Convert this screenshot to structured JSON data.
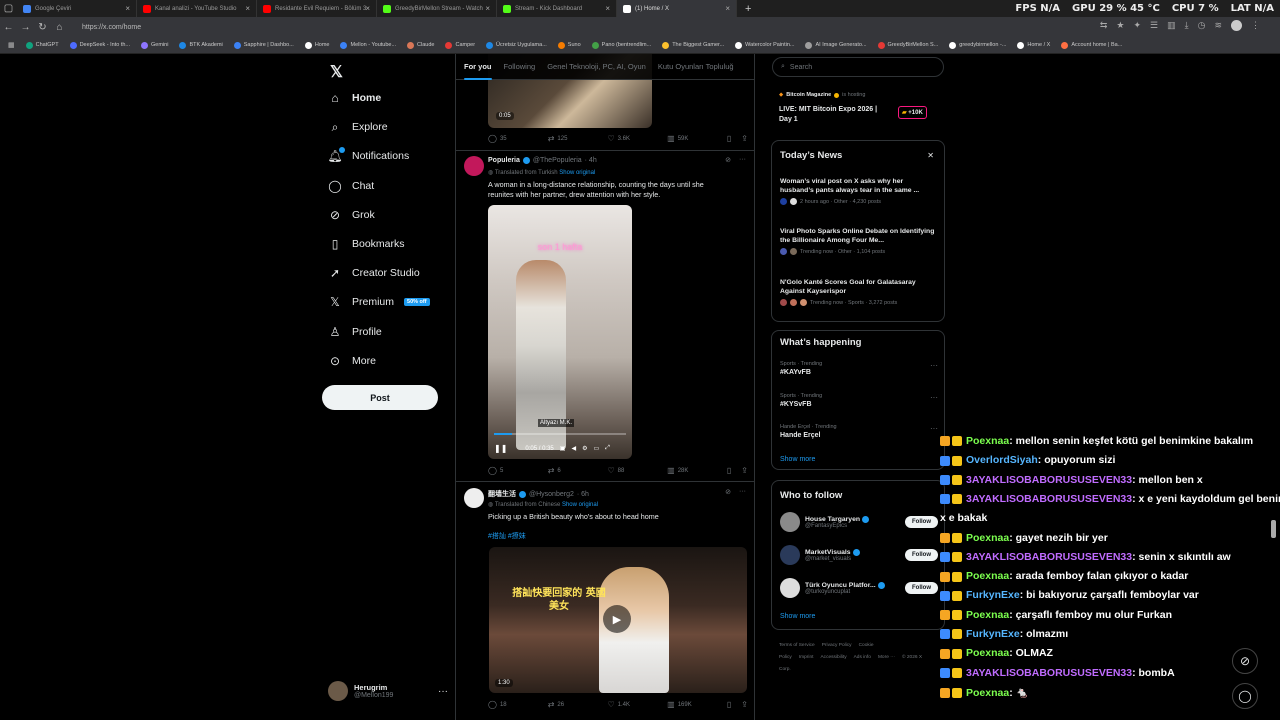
{
  "browser": {
    "tabs": [
      {
        "label": "Google Çeviri",
        "color": "#4285f4",
        "active": false
      },
      {
        "label": "Kanal analizi - YouTube Studio",
        "color": "#ff0000",
        "active": false
      },
      {
        "label": "Residante Evil Requiem - Bölüm 3",
        "color": "#ff0000",
        "active": false
      },
      {
        "label": "GreedyBirMellon Stream - Watch",
        "color": "#53fc18",
        "active": false
      },
      {
        "label": "Stream - Kick Dashboard",
        "color": "#53fc18",
        "active": false
      },
      {
        "label": "(1) Home / X",
        "color": "#ffffff",
        "active": true
      }
    ],
    "new_tab": "+",
    "stats": {
      "fps_label": "FPS",
      "fps_value": "N/A",
      "gpu_label": "GPU",
      "gpu_value": "29 % 45 °C",
      "cpu_label": "CPU",
      "cpu_value": "7 %",
      "lat_label": "LAT",
      "lat_value": "N/A"
    },
    "url": "https://x.com/home",
    "bookmarks": [
      {
        "label": "ChatGPT",
        "color": "#10a37f"
      },
      {
        "label": "DeepSeek - Into th...",
        "color": "#4d6bfe"
      },
      {
        "label": "Gemini",
        "color": "#8e75ff"
      },
      {
        "label": "BTK Akademi",
        "color": "#1e88e5"
      },
      {
        "label": "Sapphire | Dashbo...",
        "color": "#3b82f6"
      },
      {
        "label": "Home",
        "color": "#ffffff"
      },
      {
        "label": "Mellon - Youtube...",
        "color": "#3b82f6"
      },
      {
        "label": "Claude",
        "color": "#d97757"
      },
      {
        "label": "Camper",
        "color": "#e53935"
      },
      {
        "label": "Ücretsiz Uygulama...",
        "color": "#1e88e5"
      },
      {
        "label": "Suno",
        "color": "#f57c00"
      },
      {
        "label": "Pano (bentrendlim...",
        "color": "#43a047"
      },
      {
        "label": "The Biggest Gamer...",
        "color": "#fbc02d"
      },
      {
        "label": "Watercolor Paintin...",
        "color": "#ffffff"
      },
      {
        "label": "AI Image Generato...",
        "color": "#9e9e9e"
      },
      {
        "label": "GreedyBirMellon S...",
        "color": "#e53935"
      },
      {
        "label": "greedybirmellon -...",
        "color": "#ffffff"
      },
      {
        "label": "Home / X",
        "color": "#ffffff"
      },
      {
        "label": "Account home | Ba...",
        "color": "#ff7043"
      }
    ]
  },
  "nav": {
    "logo": "𝕏",
    "items": [
      {
        "label": "Home",
        "icon": "home-icon",
        "glyph": "⌂",
        "bold": true
      },
      {
        "label": "Explore",
        "icon": "search-icon",
        "glyph": "⌕"
      },
      {
        "label": "Notifications",
        "icon": "bell-icon",
        "glyph": "🔔︎",
        "badge": true
      },
      {
        "label": "Chat",
        "icon": "chat-icon",
        "glyph": "◯"
      },
      {
        "label": "Grok",
        "icon": "grok-icon",
        "glyph": "⊘"
      },
      {
        "label": "Bookmarks",
        "icon": "bookmark-icon",
        "glyph": "▯"
      },
      {
        "label": "Creator Studio",
        "icon": "rocket-icon",
        "glyph": "➚"
      },
      {
        "label": "Premium",
        "icon": "x-icon",
        "glyph": "𝕏",
        "tag": "50% off"
      },
      {
        "label": "Profile",
        "icon": "person-icon",
        "glyph": "♙"
      },
      {
        "label": "More",
        "icon": "more-circle-icon",
        "glyph": "⊙"
      }
    ],
    "post_label": "Post",
    "user": {
      "name": "Herugrim",
      "handle": "@Mellon199",
      "more": "···"
    }
  },
  "feed": {
    "tabs": [
      "For you",
      "Following",
      "Genel Teknoloji, PC, AI, Oyun",
      "Kutu Oyunları Topluluğ"
    ],
    "top_video_time": "0:05",
    "top_actions": {
      "replies": "35",
      "reposts": "125",
      "likes": "3.6K",
      "views": "59K"
    },
    "tweet1": {
      "name": "Populeria",
      "handle": "@ThePopuleria",
      "time": "· 4h",
      "translated": "Translated from Turkish",
      "show_original": "Show original",
      "text": "A woman in a long-distance relationship, counting the days until she reunites with her partner, drew attention with her style.",
      "video_caption": "son 1 hafta",
      "video_subtitle": "Altyazı M.K.",
      "video_time": "0:05 / 0:35",
      "actions": {
        "replies": "5",
        "reposts": "6",
        "likes": "88",
        "views": "28K"
      }
    },
    "tweet2": {
      "name": "翻墙生活",
      "handle": "@Hysonberg2",
      "time": "· 6h",
      "translated": "Translated from Chinese",
      "show_original": "Show original",
      "text": "Picking up a British beauty who's about to head home",
      "tags": "#搭訕 #撩妹",
      "video_overlay": "搭訕快要回家的 英國美女",
      "video_time": "1:30",
      "actions": {
        "replies": "18",
        "reposts": "26",
        "likes": "1.4K",
        "views": "169K"
      }
    }
  },
  "right": {
    "search_placeholder": "Search",
    "live": {
      "host": "Bitcoin Magazine",
      "hosting": "is hosting",
      "title": "LIVE: MIT Bitcoin Expo 2026 | Day 1",
      "count": "+10K"
    },
    "news": {
      "title": "Today’s News",
      "close": "✕",
      "items": [
        {
          "title": "Woman’s viral post on X asks why her husband’s pants always tear in the same ...",
          "meta": "2 hours ago · Other · 4,230 posts"
        },
        {
          "title": "Viral Photo Sparks Online Debate on Identifying the Billionaire Among Four Me...",
          "meta": "Trending now · Other · 1,104 posts"
        },
        {
          "title": "N'Golo Kanté Scores Goal for Galatasaray Against Kayserispor",
          "meta": "Trending now · Sports · 3,272 posts"
        }
      ]
    },
    "happening": {
      "title": "What’s happening",
      "trends": [
        {
          "context": "Sports · Trending",
          "name": "#KAYvFB"
        },
        {
          "context": "Sports · Trending",
          "name": "#KYSvFB"
        },
        {
          "context": "Hande Erçel · Trending",
          "name": "Hande Erçel"
        }
      ],
      "show_more": "Show more"
    },
    "follow": {
      "title": "Who to follow",
      "items": [
        {
          "name": "House Targaryen",
          "handle": "@FantasyEpics",
          "color": "#8a8a8a"
        },
        {
          "name": "MarketVisuals",
          "handle": "@market_visuals",
          "color": "#2a3a5a"
        },
        {
          "name": "Türk Oyuncu Platfor...",
          "handle": "@turkoyuncuplat",
          "color": "#dddddd"
        }
      ],
      "button": "Follow",
      "show_more": "Show more"
    },
    "footer": [
      "Terms of Service",
      "Privacy Policy",
      "Cookie Policy",
      "Imprint",
      "Accessibility",
      "Ads info",
      "More ···",
      "© 2026 X Corp."
    ]
  },
  "chat": {
    "messages": [
      {
        "user": "Poexnaa",
        "color": "#7cff4f",
        "text": ": mellon senin keşfet kötü gel benimkine bakalım"
      },
      {
        "user": "OverlordSiyah",
        "color": "#56b6ff",
        "text": ": opuyorum sizi"
      },
      {
        "user": "3AYAKLISOBABORUSUSEVEN33",
        "color": "#c06cff",
        "text": ": mellon ben x"
      },
      {
        "user": "3AYAKLISOBABORUSUSEVEN33",
        "color": "#c06cff",
        "text": ": x e yeni kaydoldum gel benim"
      },
      {
        "user": "",
        "color": "#ffffff",
        "text": "x e bakak"
      },
      {
        "user": "Poexnaa",
        "color": "#7cff4f",
        "text": ": gayet nezih bir yer"
      },
      {
        "user": "3AYAKLISOBABORUSUSEVEN33",
        "color": "#c06cff",
        "text": ": senin x sıkıntılı aw"
      },
      {
        "user": "Poexnaa",
        "color": "#7cff4f",
        "text": ": arada femboy falan çıkıyor o kadar"
      },
      {
        "user": "FurkynExe",
        "color": "#56b6ff",
        "text": ": bi bakıyoruz çarşaflı femboylar var"
      },
      {
        "user": "Poexnaa",
        "color": "#7cff4f",
        "text": ": çarşaflı femboy mu olur Furkan"
      },
      {
        "user": "FurkynExe",
        "color": "#56b6ff",
        "text": ": olmazmı"
      },
      {
        "user": "Poexnaa",
        "color": "#7cff4f",
        "text": ": OLMAZ"
      },
      {
        "user": "3AYAKLISOBABORUSUSEVEN33",
        "color": "#c06cff",
        "text": ": bombA"
      },
      {
        "user": "Poexnaa",
        "color": "#7cff4f",
        "text": ": 🐁"
      }
    ]
  }
}
